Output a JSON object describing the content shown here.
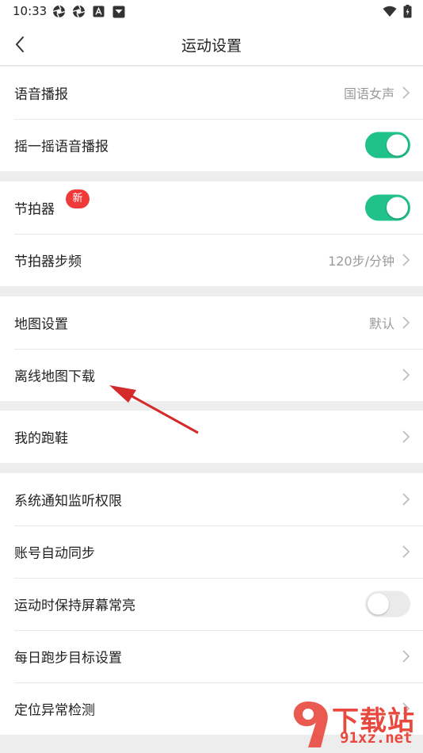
{
  "status_bar": {
    "time": "10:33",
    "left_icons": [
      "aperture-icon",
      "aperture-icon",
      "a-box-icon",
      "dropdown-box-icon"
    ],
    "right_icons": [
      "wifi-icon",
      "battery-charging-icon"
    ]
  },
  "header": {
    "title": "运动设置"
  },
  "groups": [
    {
      "rows": [
        {
          "label": "语音播报",
          "value": "国语女声",
          "control": "chevron"
        },
        {
          "label": "摇一摇语音播报",
          "control": "toggle",
          "on": true
        }
      ]
    },
    {
      "rows": [
        {
          "label": "节拍器",
          "badge": "新",
          "control": "toggle",
          "on": true
        },
        {
          "label": "节拍器步频",
          "value": "120步/分钟",
          "control": "chevron"
        }
      ]
    },
    {
      "rows": [
        {
          "label": "地图设置",
          "value": "默认",
          "control": "chevron"
        },
        {
          "label": "离线地图下载",
          "control": "chevron"
        }
      ]
    },
    {
      "rows": [
        {
          "label": "我的跑鞋",
          "control": "chevron"
        }
      ]
    },
    {
      "rows": [
        {
          "label": "系统通知监听权限",
          "control": "chevron"
        },
        {
          "label": "账号自动同步",
          "control": "chevron"
        },
        {
          "label": "运动时保持屏幕常亮",
          "control": "toggle",
          "on": false
        },
        {
          "label": "每日跑步目标设置",
          "control": "chevron"
        },
        {
          "label": "定位异常检测",
          "control": "chevron"
        }
      ]
    }
  ],
  "watermark": {
    "brand": "下载站",
    "site": "91xz.net"
  },
  "colors": {
    "toggle_on": "#21c18a",
    "badge": "#f03a3a",
    "arrow": "#d42a2a",
    "background": "#ededed"
  }
}
